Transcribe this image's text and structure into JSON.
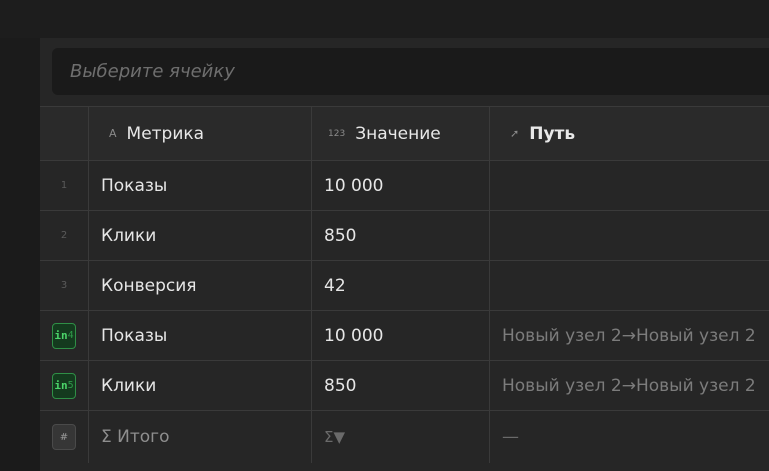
{
  "search": {
    "placeholder": "Выберите ячейку"
  },
  "columns": [
    {
      "icon": "A",
      "label": "Метрика"
    },
    {
      "icon": "123",
      "label": "Значение"
    },
    {
      "icon": "➚",
      "label": "Путь"
    }
  ],
  "rows": [
    {
      "num": "1",
      "metric": "Показы",
      "value": "10 000",
      "path": ""
    },
    {
      "num": "2",
      "metric": "Клики",
      "value": "850",
      "path": ""
    },
    {
      "num": "3",
      "metric": "Конверсия",
      "value": "42",
      "path": ""
    },
    {
      "badge_prefix": "in",
      "num": "4",
      "metric": "Показы",
      "value": "10 000",
      "path": "Новый узел 2→Новый узел 2"
    },
    {
      "badge_prefix": "in",
      "num": "5",
      "metric": "Клики",
      "value": "850",
      "path": "Новый узел 2→Новый узел 2"
    }
  ],
  "total": {
    "badge": "#",
    "label": "Σ Итого",
    "aggregate": "Σ",
    "caret": "▼",
    "path": "—"
  }
}
